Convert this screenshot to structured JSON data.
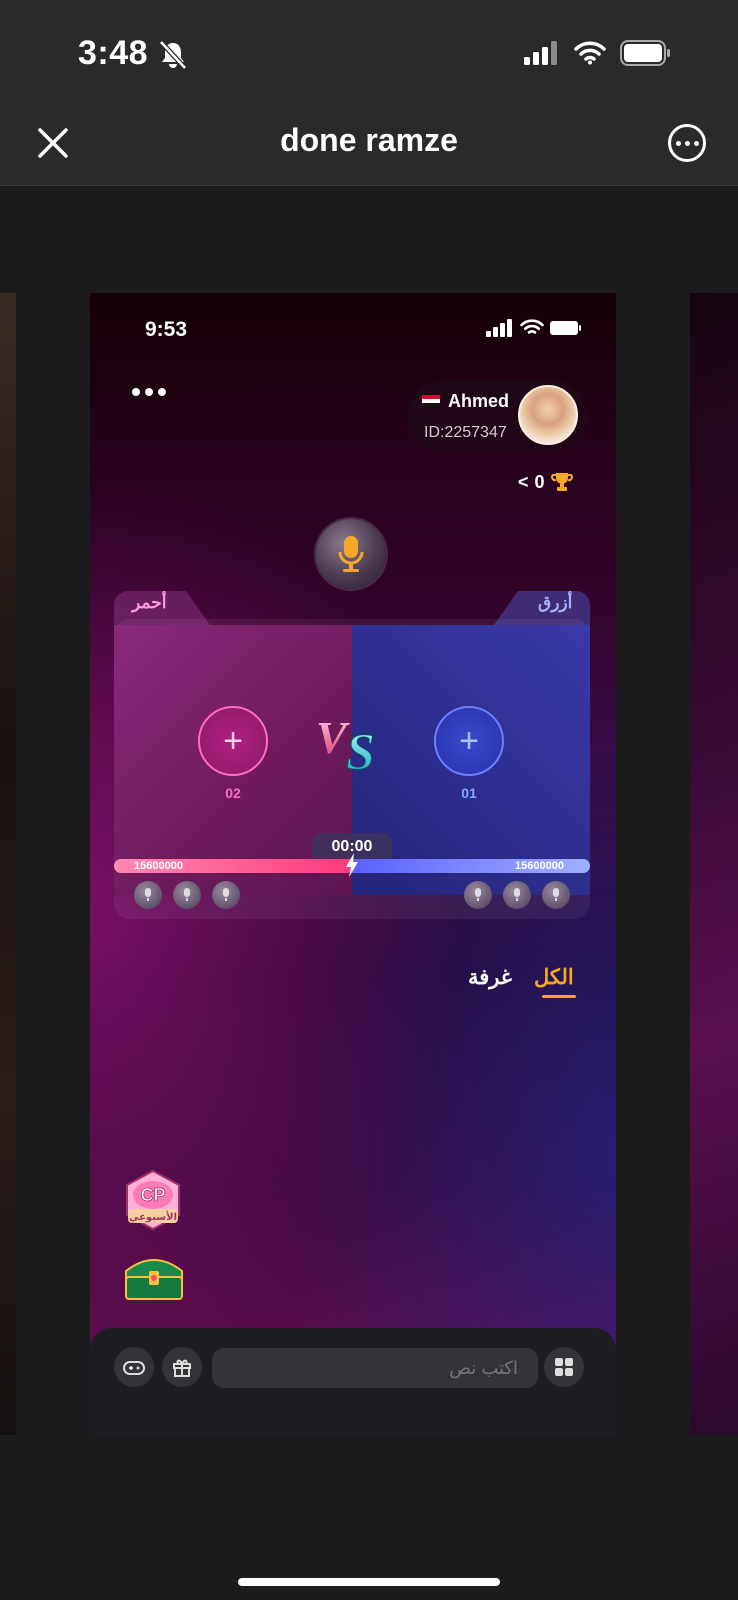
{
  "ios_status": {
    "time": "3:48"
  },
  "navbar": {
    "title": "done ramze"
  },
  "card": {
    "status_time": "9:53",
    "profile": {
      "name": "Ahmed",
      "id": "ID:2257347"
    },
    "trophy": {
      "count": "0",
      "arrow": "<"
    },
    "pk": {
      "red_label": "أحمر",
      "blue_label": "أزرق",
      "red_seat_number": "02",
      "blue_seat_number": "01",
      "vs_text": "VS",
      "timer": "00:00",
      "red_score": "15600000",
      "blue_score": "15600000"
    },
    "tabs": {
      "all": "الكل",
      "room": "غرفة"
    },
    "cp_badge": {
      "line1": "CP",
      "line2": "الأسبوعي"
    },
    "input_placeholder": "اكتب نص"
  },
  "colors": {
    "accent_orange": "#f7a726",
    "red_team": "#ff3a7a",
    "blue_team": "#5a60ff"
  }
}
